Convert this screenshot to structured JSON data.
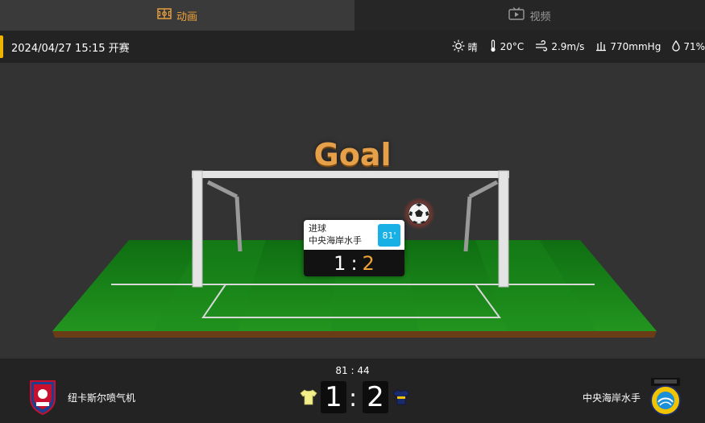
{
  "tabs": [
    {
      "label": "动画",
      "icon": "pitch-icon",
      "active": true
    },
    {
      "label": "视频",
      "icon": "tv-icon",
      "active": false
    }
  ],
  "match": {
    "start_info": "2024/04/27 15:15 开赛"
  },
  "weather": {
    "condition": "晴",
    "temperature": "20°C",
    "wind": "2.9m/s",
    "pressure": "770mmHg",
    "humidity": "71%"
  },
  "animation": {
    "title": "Goal",
    "event_type": "进球",
    "event_team": "中央海岸水手",
    "event_minute": "81'",
    "score_home": "1",
    "score_sep": ":",
    "score_away": "2"
  },
  "scoreboard": {
    "clock": "81 : 44",
    "home_team": "纽卡斯尔喷气机",
    "away_team": "中央海岸水手",
    "home_score": "1",
    "away_score": "2",
    "separator": ":"
  },
  "colors": {
    "accent": "#f0a33a",
    "goal_title": "#e6a04a",
    "minute_badge": "#19b0e6",
    "pitch": "#1a8a1a",
    "home_shirt": "#f2ef8a",
    "away_shirt": "#1b2a6b"
  }
}
